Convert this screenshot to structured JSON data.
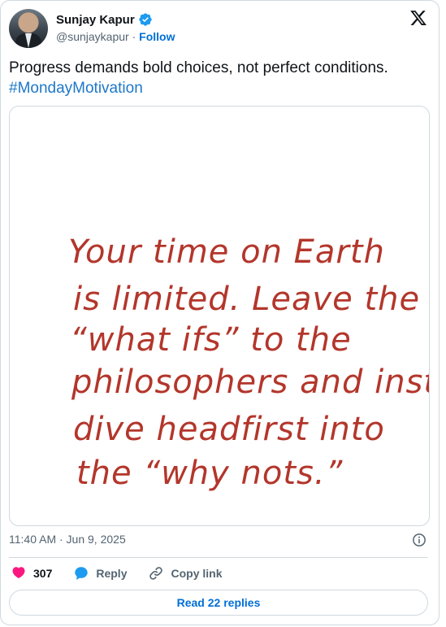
{
  "author": {
    "name": "Sunjay Kapur",
    "handle": "@sunjaykapur",
    "separator": " · ",
    "follow_label": "Follow",
    "avatar_icon": "user-avatar-photo",
    "verified_icon": "verified-badge-icon",
    "verified_color": "#1d9bf0"
  },
  "platform_icon": "x-logo-icon",
  "tweet": {
    "text": "Progress demands bold choices, not perfect conditions.",
    "hashtag": "#MondayMotivation",
    "hashtag_color": "#1d77c8"
  },
  "media": {
    "quote_lines": [
      "Your time on Earth",
      "is limited. Leave the",
      "“what ifs” to the",
      "philosophers and instead",
      "dive headfirst into",
      "the “why nots.”"
    ],
    "ink_color": "#b3362b"
  },
  "meta": {
    "timestamp": "11:40 AM · Jun 9, 2025",
    "info_icon": "info-circle-icon"
  },
  "actions": {
    "like": {
      "icon": "heart-icon",
      "count": "307",
      "color": "#f91880"
    },
    "reply": {
      "icon": "speech-bubble-icon",
      "label": "Reply",
      "color": "#1d9bf0"
    },
    "copy_link": {
      "icon": "link-icon",
      "label": "Copy link"
    }
  },
  "read_replies_label": "Read 22 replies",
  "accent_color": "#006fd6"
}
